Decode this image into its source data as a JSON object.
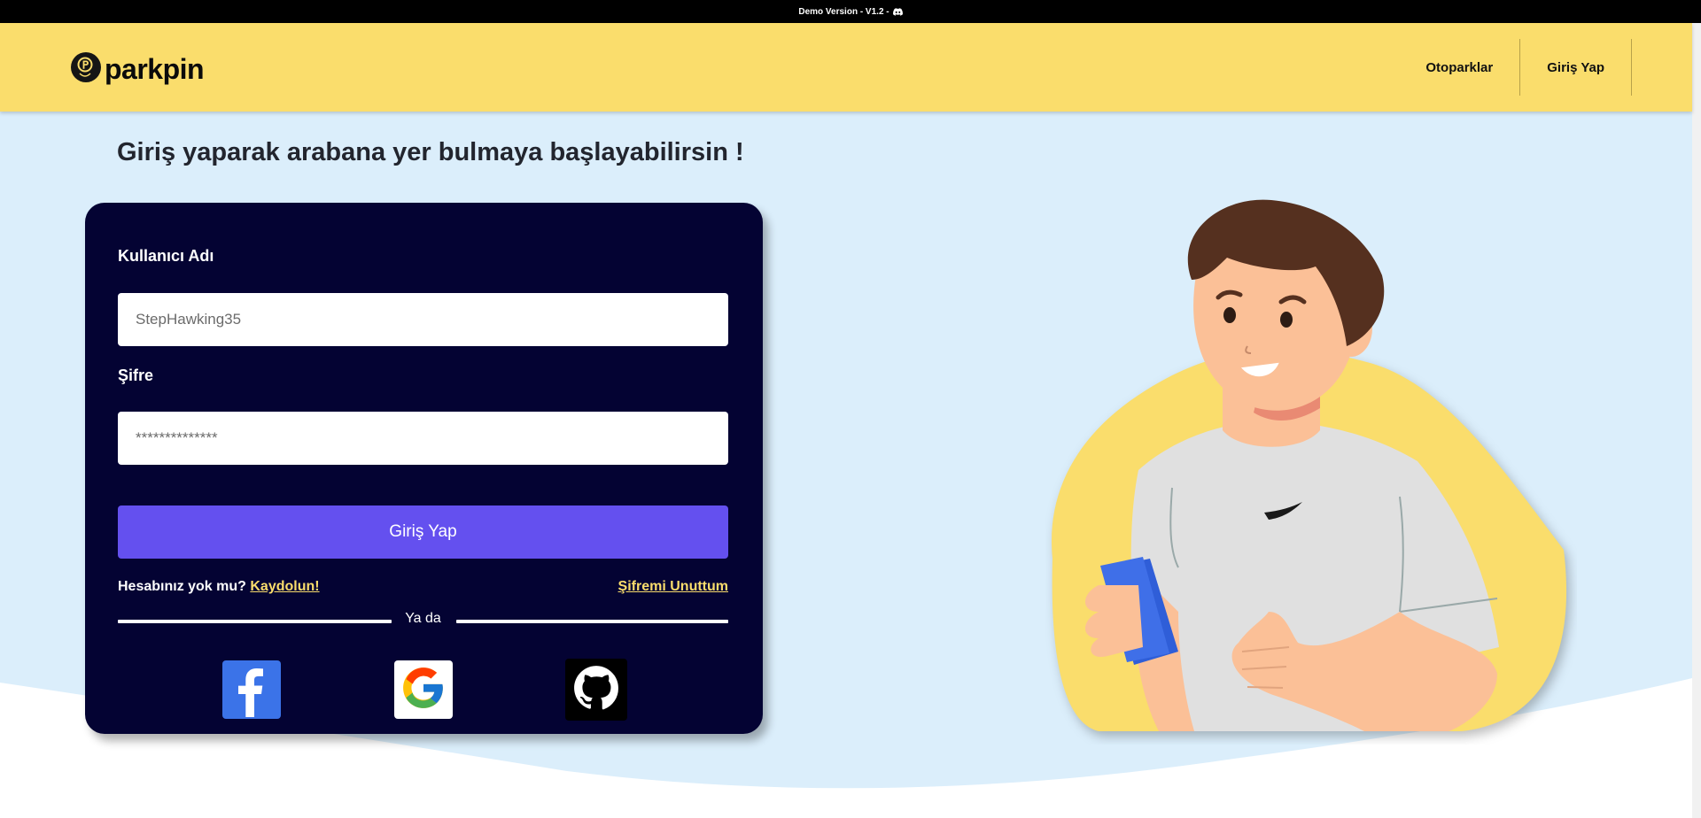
{
  "demo_bar": {
    "text": "Demo Version - V1.2 -"
  },
  "header": {
    "logo_text": "parkpin",
    "nav": [
      {
        "label": "Otoparklar"
      },
      {
        "label": "Giriş Yap"
      }
    ]
  },
  "main": {
    "headline": "Giriş yaparak arabana yer bulmaya başlayabilirsin !"
  },
  "login_form": {
    "username_label": "Kullanıcı Adı",
    "username_placeholder": "StepHawking35",
    "password_label": "Şifre",
    "password_placeholder": "**************",
    "submit_label": "Giriş Yap",
    "no_account_text": "Hesabınız yok mu?",
    "register_link": "Kaydolun!",
    "forgot_link": "Şifremi Unuttum",
    "divider_text": "Ya da"
  },
  "colors": {
    "header_bg": "#fadd6c",
    "card_bg": "#040333",
    "button_bg": "#6450ef",
    "main_bg": "#dbeefb",
    "link": "#fadd6c"
  },
  "icons": [
    "discord-icon",
    "logo-pin-icon",
    "facebook-icon",
    "google-icon",
    "github-icon"
  ]
}
